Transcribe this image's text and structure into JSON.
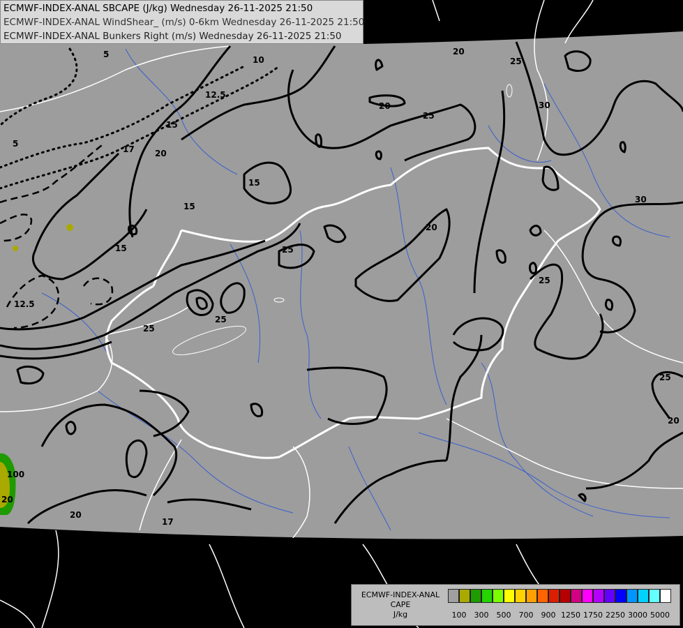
{
  "header": {
    "line1": "ECMWF-INDEX-ANAL SBCAPE (J/kg) Wednesday 26-11-2025 21:50",
    "line2": "ECMWF-INDEX-ANAL WindShear_ (m/s) 0-6km Wednesday 26-11-2025 21:50",
    "line3": "ECMWF-INDEX-ANAL Bunkers Right (m/s) Wednesday 26-11-2025 21:50"
  },
  "contour_labels": [
    "5",
    "5",
    "10",
    "12.5",
    "15",
    "17",
    "20",
    "20",
    "20",
    "25",
    "25",
    "30",
    "30",
    "20",
    "15",
    "15",
    "15",
    "25",
    "25",
    "25",
    "25",
    "25",
    "20",
    "12.5",
    "100",
    "20",
    "20",
    "17"
  ],
  "legend": {
    "line1": "ECMWF-INDEX-ANAL",
    "line2": "CAPE",
    "line3": "J/kg",
    "colors": [
      "#a0a0a0",
      "#a9a900",
      "#1f9a00",
      "#25d400",
      "#7bff00",
      "#ffff00",
      "#ffd200",
      "#ffa000",
      "#ff6400",
      "#dc1e00",
      "#b40000",
      "#d20082",
      "#ff00ff",
      "#b400ff",
      "#6400ff",
      "#0000ff",
      "#0096ff",
      "#00d2ff",
      "#64ffff",
      "#ffffff"
    ],
    "ticks": [
      "100",
      "300",
      "500",
      "700",
      "900",
      "1250",
      "1750",
      "2250",
      "3000",
      "5000"
    ]
  },
  "colors": {
    "data_area": "#9d9d9d",
    "background": "#000000",
    "border_line": "#ffffff",
    "river_line": "#3a5fcd",
    "contour_line": "#000000"
  }
}
